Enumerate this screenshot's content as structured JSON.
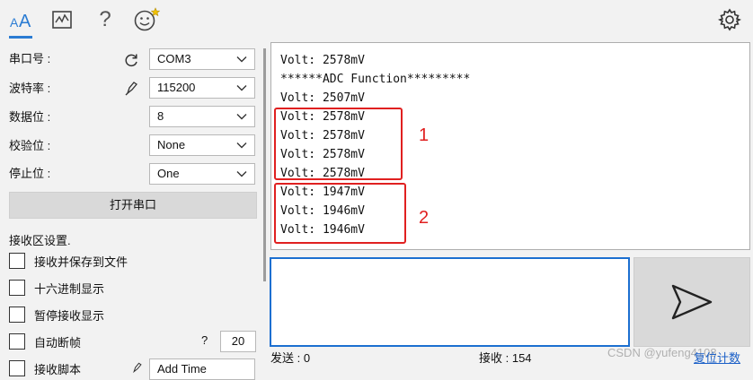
{
  "toolbar": {
    "icons": [
      "font-size-icon",
      "chart-icon",
      "help-icon",
      "smiley-icon",
      "gear-icon"
    ],
    "help_glyph": "?"
  },
  "settings": {
    "port": {
      "label": "串口号 :",
      "value": "COM3"
    },
    "baud": {
      "label": "波特率 :",
      "value": "115200"
    },
    "databits": {
      "label": "数据位 :",
      "value": "8"
    },
    "parity": {
      "label": "校验位 :",
      "value": "None"
    },
    "stopbits": {
      "label": "停止位 :",
      "value": "One"
    },
    "open_button": "打开串口"
  },
  "receive_settings": {
    "title": "接收区设置.",
    "save_to_file": "接收并保存到文件",
    "hex_display": "十六进制显示",
    "pause_display": "暂停接收显示",
    "auto_frame": "自动断帧",
    "auto_frame_help": "?",
    "auto_frame_value": "20",
    "script_label": "接收脚本",
    "script_value": "Add Time"
  },
  "receive_log": [
    "Volt: 2578mV",
    "******ADC Function*********",
    "Volt: 2507mV",
    "Volt: 2578mV",
    "Volt: 2578mV",
    "Volt: 2578mV",
    "Volt: 2578mV",
    "Volt: 1947mV",
    "Volt: 1946mV",
    "Volt: 1946mV"
  ],
  "annotations": {
    "first": "1",
    "second": "2"
  },
  "status": {
    "sent": "发送 : 0",
    "received": "接收 : 154",
    "reset": "复位计数"
  },
  "watermark": "CSDN @yufeng4108",
  "colors": {
    "accent": "#2b7cd3",
    "annotation": "#e02020"
  }
}
